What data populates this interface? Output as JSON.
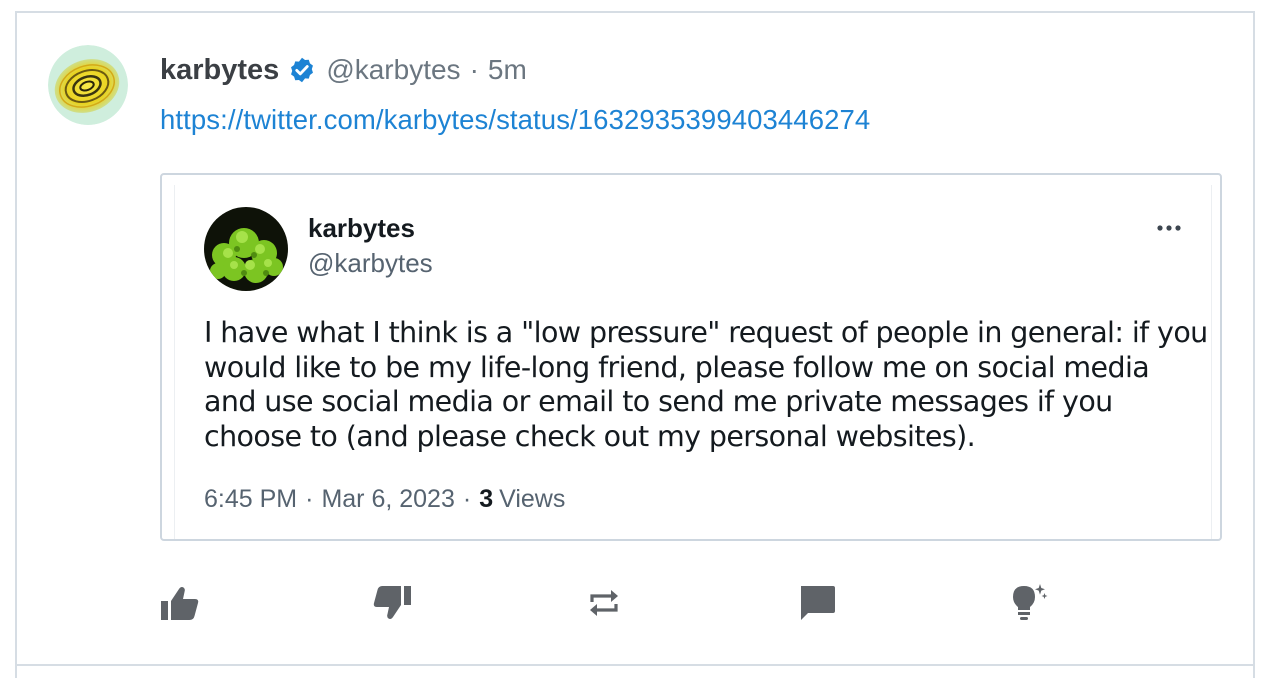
{
  "post": {
    "display_name": "karbytes",
    "handle": "@karbytes",
    "separator": "·",
    "time": "5m",
    "link_text": "https://twitter.com/karbytes/status/1632935399403446274"
  },
  "quoted": {
    "display_name": "karbytes",
    "handle": "@karbytes",
    "text_lines": [
      "I have what I think is a \"low pressure\" request of people in general: if you",
      "would like to be my life-long friend, please follow me on social media",
      "and use social media or email to send me private messages if you",
      "choose to (and please check out my personal websites)."
    ],
    "time": "6:45 PM",
    "date": "Mar 6, 2023",
    "separator": "·",
    "views_count": "3",
    "views_label": "Views"
  },
  "icons": {
    "verified": "verified-badge-icon",
    "more": "more-horizontal-icon",
    "like": "thumbs-up-icon",
    "dislike": "thumbs-down-icon",
    "repost": "repost-icon",
    "comment": "comment-icon",
    "idea": "lightbulb-icon"
  },
  "colors": {
    "link": "#1d83d4",
    "verified": "#1d83d4",
    "icon": "#5f6368",
    "border": "#d6dde4"
  }
}
